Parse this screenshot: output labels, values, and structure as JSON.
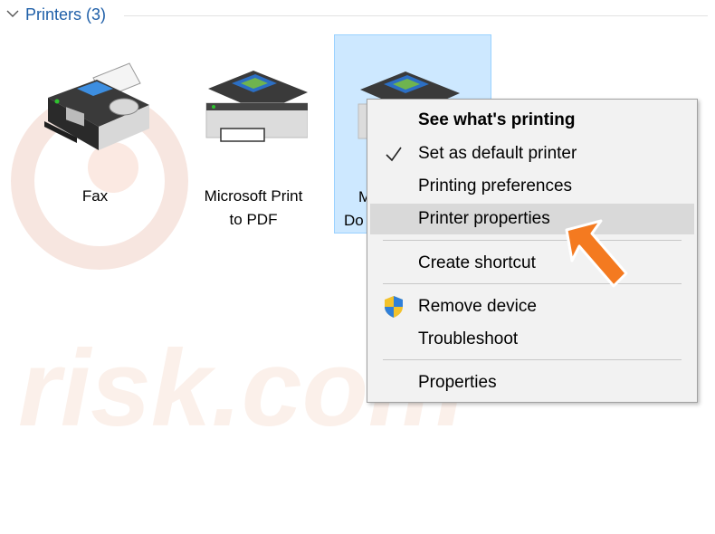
{
  "group": {
    "title": "Printers (3)",
    "icon": "chevron-down-icon"
  },
  "printers": [
    {
      "label": "Fax",
      "icon": "fax-icon"
    },
    {
      "label": "Microsoft Print to PDF",
      "line1": "Microsoft Print",
      "line2": "to PDF",
      "icon": "printer-icon"
    },
    {
      "label_visible_1": "M",
      "label_visible_2": "Do",
      "icon": "printer-icon",
      "selected": true
    }
  ],
  "context_menu": {
    "items": [
      {
        "label": "See what's printing",
        "bold": true
      },
      {
        "label": "Set as default printer",
        "icon": "checkmark-icon"
      },
      {
        "label": "Printing preferences"
      },
      {
        "label": "Printer properties",
        "highlighted": true
      },
      {
        "label": "Create shortcut"
      },
      {
        "label": "Remove device",
        "icon": "uac-shield-icon"
      },
      {
        "label": "Troubleshoot"
      },
      {
        "label": "Properties"
      }
    ]
  },
  "colors": {
    "selection_bg": "#cde8ff",
    "selection_border": "#99d1ff",
    "menu_bg": "#f2f2f2",
    "hover_bg": "#d9d9d9",
    "arrow": "#f47a20",
    "header_text": "#1f5fa8"
  }
}
